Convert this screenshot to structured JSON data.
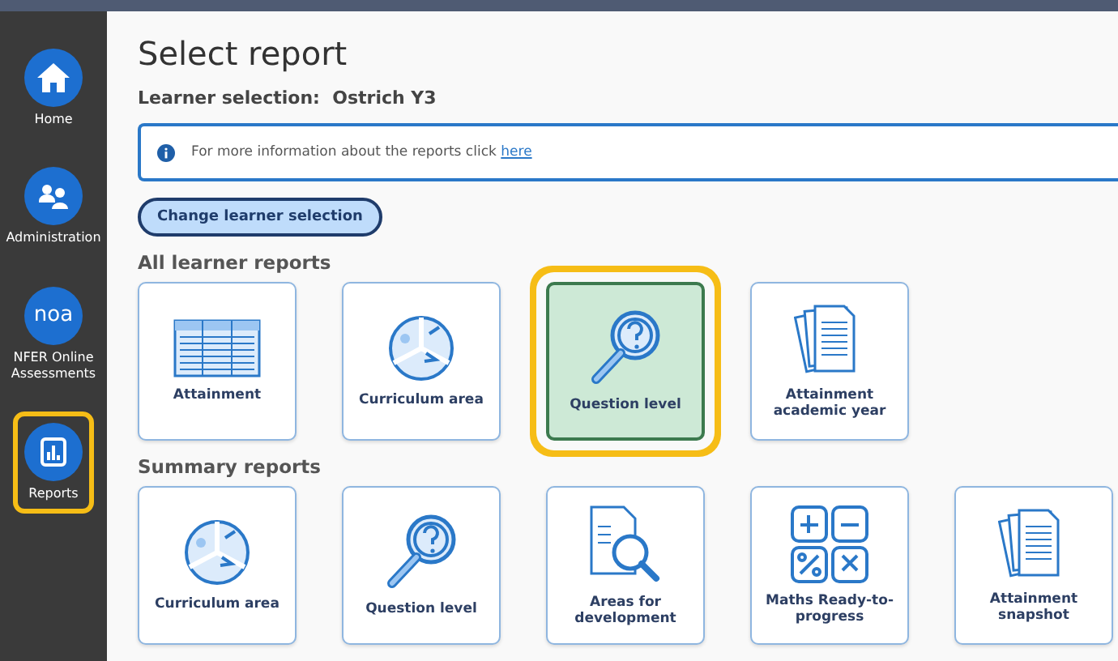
{
  "nav": [
    {
      "label": "Home",
      "kind": "home",
      "selected": false
    },
    {
      "label": "Administration",
      "kind": "people",
      "selected": false
    },
    {
      "label": "NFER Online Assessments",
      "kind": "logo",
      "logo_text": "noa",
      "selected": false
    },
    {
      "label": "Reports",
      "kind": "chart",
      "selected": true
    }
  ],
  "title": "Select report",
  "learner": {
    "label": "Learner selection:",
    "value": "Ostrich Y3"
  },
  "info": {
    "text": "For more information about the reports click",
    "link": "here"
  },
  "change_button": "Change learner selection",
  "sections": [
    {
      "heading": "All learner reports",
      "cards": [
        {
          "label": "Attainment",
          "kind": "table",
          "selected": false
        },
        {
          "label": "Curriculum area",
          "kind": "pie",
          "selected": false
        },
        {
          "label": "Question level",
          "kind": "magnifier",
          "selected": true
        },
        {
          "label": "Attainment academic year",
          "kind": "documents",
          "selected": false
        }
      ]
    },
    {
      "heading": "Summary reports",
      "cards": [
        {
          "label": "Curriculum area",
          "kind": "pie",
          "selected": false
        },
        {
          "label": "Question level",
          "kind": "magnifier",
          "selected": false
        },
        {
          "label": "Areas for development",
          "kind": "docsearch",
          "selected": false
        },
        {
          "label": "Maths Ready-to-progress",
          "kind": "math",
          "selected": false
        },
        {
          "label": "Attainment snapshot",
          "kind": "documents",
          "selected": false
        }
      ]
    }
  ]
}
